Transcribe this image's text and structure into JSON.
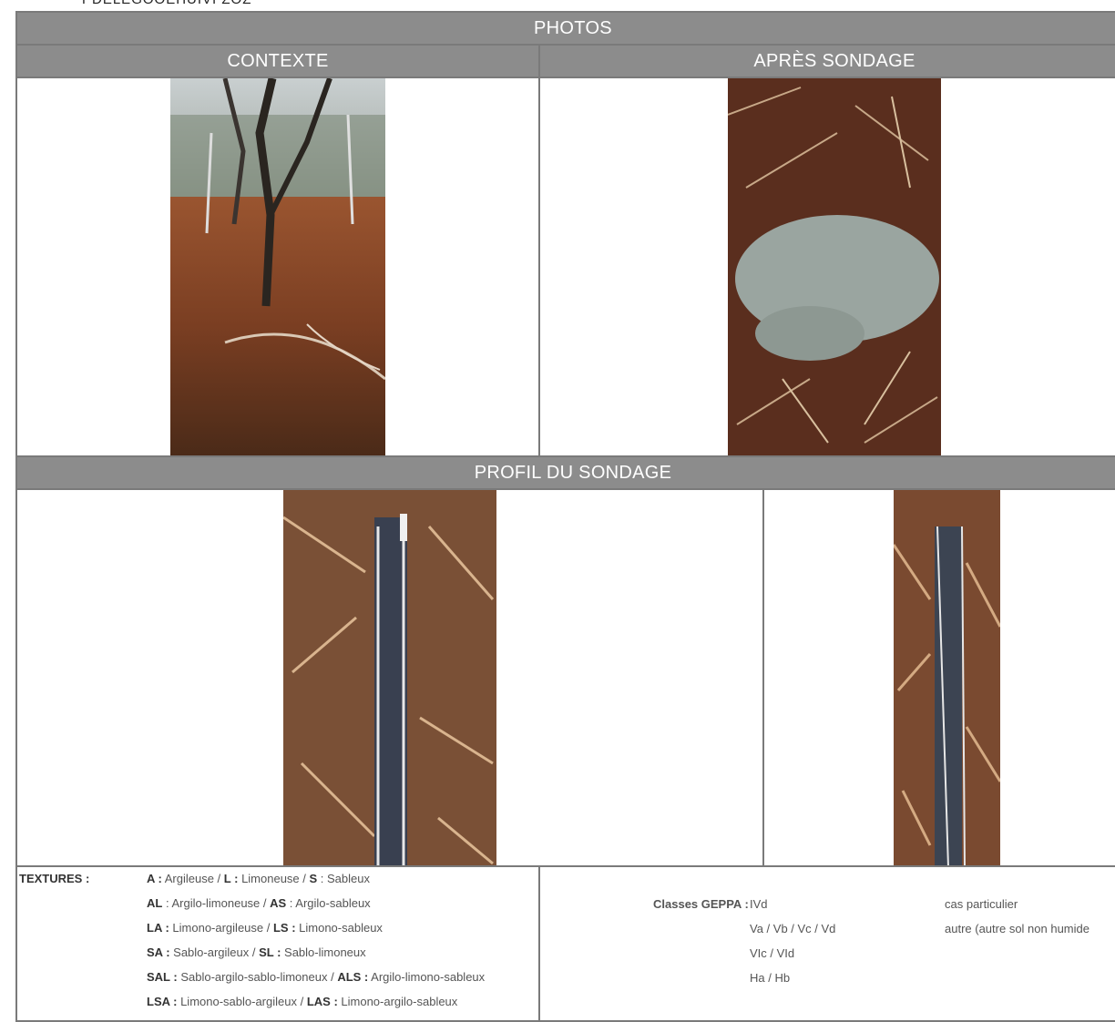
{
  "header": {
    "cut_text": "PDELEGOOEHUIVI ZOZ"
  },
  "sections": {
    "photos_title": "PHOTOS",
    "contexte_title": "CONTEXTE",
    "apres_title": "APRÈS SONDAGE",
    "profil_title": "PROFIL DU SONDAGE"
  },
  "textures": {
    "label": "TEXTURES :",
    "lines": [
      {
        "k1": "A :",
        "v1": " Argileuse / ",
        "k2": "L :",
        "v2": " Limoneuse / ",
        "k3": "S",
        "v3": " : Sableux"
      },
      {
        "k1": "AL",
        "v1": " : Argilo-limoneuse / ",
        "k2": "AS",
        "v2": " : Argilo-sableux",
        "k3": "",
        "v3": ""
      },
      {
        "k1": "LA :",
        "v1": " Limono-argileuse / ",
        "k2": "LS :",
        "v2": " Limono-sableux",
        "k3": "",
        "v3": ""
      },
      {
        "k1": "SA :",
        "v1": " Sablo-argileux / ",
        "k2": "SL :",
        "v2": " Sablo-limoneux",
        "k3": "",
        "v3": ""
      },
      {
        "k1": "SAL :",
        "v1": " Sablo-argilo-sablo-limoneux  / ",
        "k2": "ALS :",
        "v2": " Argilo-limono-sableux",
        "k3": "",
        "v3": ""
      },
      {
        "k1": "LSA :",
        "v1": " Limono-sablo-argileux /  ",
        "k2": "LAS :",
        "v2": " Limono-argilo-sableux",
        "k3": "",
        "v3": ""
      }
    ]
  },
  "geppa": {
    "label": "Classes GEPPA :",
    "classes": [
      "IVd",
      "Va / Vb / Vc / Vd",
      "VIc / VId",
      "Ha / Hb"
    ],
    "notes": [
      "cas particulier",
      "autre (autre sol non humide"
    ]
  }
}
